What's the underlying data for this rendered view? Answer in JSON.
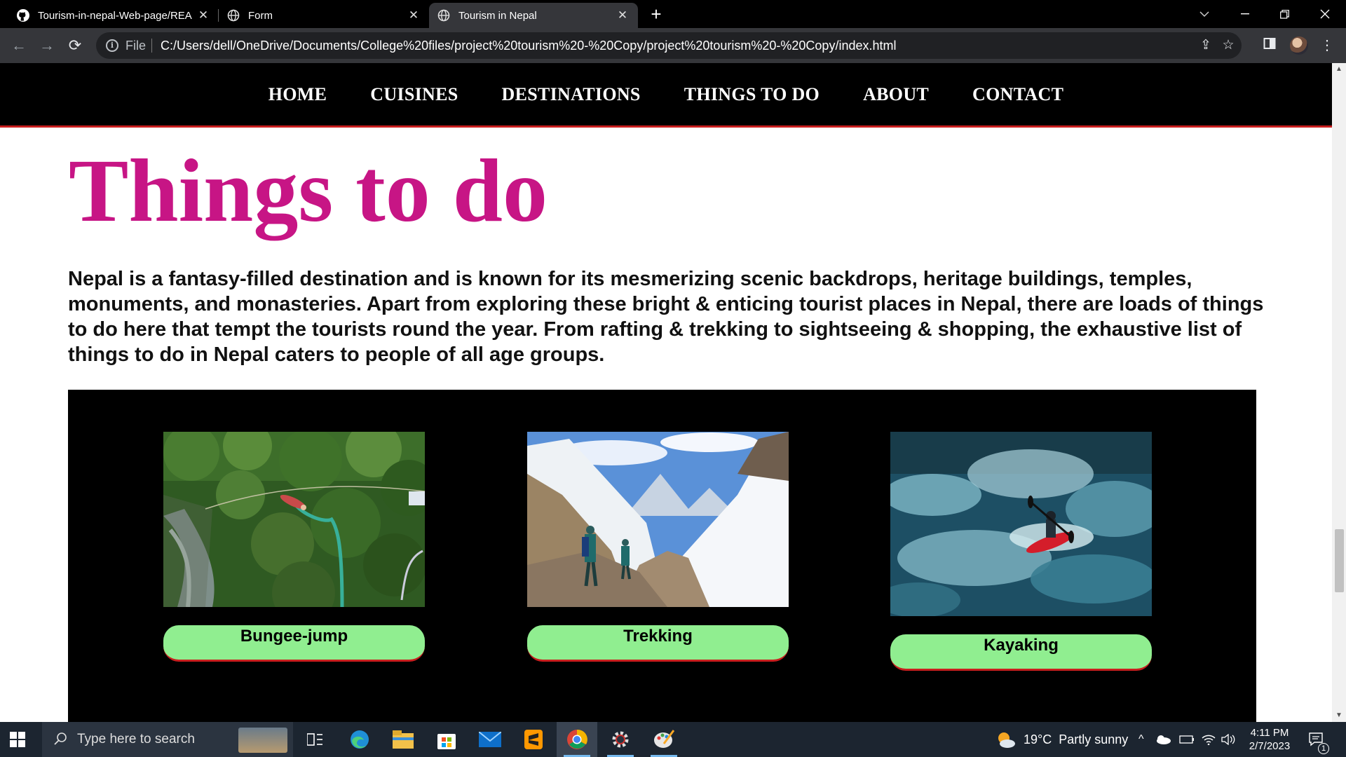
{
  "browser": {
    "tabs": [
      {
        "title": "Tourism-in-nepal-Web-page/REA",
        "icon": "github-icon"
      },
      {
        "title": "Form",
        "icon": "globe-icon"
      },
      {
        "title": "Tourism in Nepal",
        "icon": "globe-icon",
        "active": true
      }
    ],
    "address": {
      "scheme_label": "File",
      "url": "C:/Users/dell/OneDrive/Documents/College%20files/project%20tourism%20-%20Copy/project%20tourism%20-%20Copy/index.html"
    }
  },
  "site": {
    "nav": [
      "HOME",
      "CUISINES",
      "DESTINATIONS",
      "THINGS TO DO",
      "ABOUT",
      "CONTACT"
    ],
    "heading": "Things to do",
    "intro": "Nepal is a fantasy-filled destination and is known for its mesmerizing scenic backdrops, heritage buildings, temples, monuments, and monasteries. Apart from exploring these bright & enticing tourist places in Nepal, there are loads of things to do here that tempt the tourists round the year. From rafting & trekking to sightseeing & shopping, the exhaustive list of things to do in Nepal caters to people of all age groups.",
    "activities": [
      {
        "label": "Bungee-jump",
        "image": "bungee jumper over forested gorge and river"
      },
      {
        "label": "Trekking",
        "image": "two trekkers on snowy mountain trail"
      },
      {
        "label": "Kayaking",
        "image": "kayaker in red kayak on whitewater"
      }
    ],
    "colors": {
      "heading": "#c71585",
      "nav_bg": "#000000",
      "nav_border": "#c81e1e",
      "label_bg": "#90ee90"
    }
  },
  "taskbar": {
    "search_placeholder": "Type here to search",
    "weather": "19°C  Partly sunny",
    "time": "4:11 PM",
    "date": "2/7/2023",
    "notification_count": "1"
  }
}
